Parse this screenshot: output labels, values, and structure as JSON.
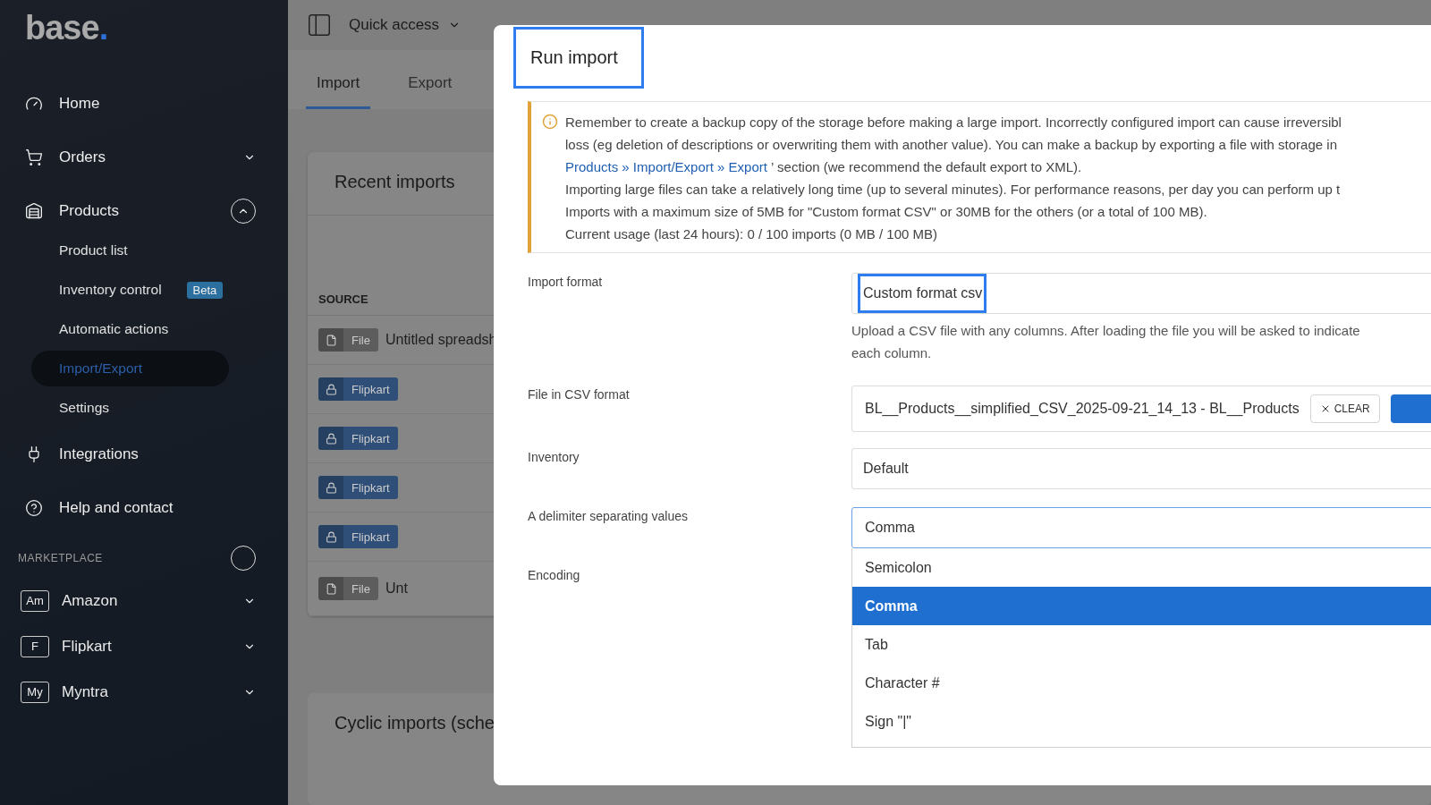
{
  "sidebar": {
    "logo": "base",
    "logo_dot": ".",
    "items": [
      {
        "label": "Home"
      },
      {
        "label": "Orders",
        "expanded": false
      },
      {
        "label": "Products",
        "expanded": true,
        "children": [
          {
            "label": "Product list",
            "selected": false
          },
          {
            "label": "Inventory control",
            "selected": false,
            "badge": "Beta"
          },
          {
            "label": "Automatic actions",
            "selected": false
          },
          {
            "label": "Import/Export",
            "selected": true
          },
          {
            "label": "Settings",
            "selected": false
          }
        ]
      },
      {
        "label": "Integrations"
      },
      {
        "label": "Help and contact"
      }
    ],
    "section": "MARKETPLACE",
    "marketplaces": [
      {
        "badge": "Am",
        "label": "Amazon"
      },
      {
        "badge": "F",
        "label": "Flipkart"
      },
      {
        "badge": "My",
        "label": "Myntra"
      }
    ]
  },
  "topbar": {
    "quick_access": "Quick access"
  },
  "tabs": [
    {
      "label": "Import",
      "selected": true
    },
    {
      "label": "Export",
      "selected": false
    }
  ],
  "recent_imports": {
    "title": "Recent imports",
    "column": "SOURCE",
    "rows": [
      {
        "kind": "file",
        "source": "File",
        "name": "Untitled spreadsh"
      },
      {
        "kind": "channel",
        "source": "Flipkart"
      },
      {
        "kind": "channel",
        "source": "Flipkart"
      },
      {
        "kind": "channel",
        "source": "Flipkart"
      },
      {
        "kind": "channel",
        "source": "Flipkart"
      },
      {
        "kind": "file",
        "source": "File",
        "name": "Unt"
      }
    ]
  },
  "cyclic_imports": {
    "title": "Cyclic imports (sche"
  },
  "modal": {
    "title": "Run import",
    "title_highlighted": true,
    "notice": [
      {
        "text": "Remember to create a backup copy of the storage before making a large import. Incorrectly configured import can cause irreversibl"
      },
      {
        "text": "loss (eg deletion of descriptions or overwriting them with another value). You can make a backup by exporting a file with storage in"
      },
      {
        "link": "Products » Import/Export » Export",
        "text": " ’ section (we recommend the default export to XML)."
      },
      {
        "text": "Importing large files can take a relatively long time (up to several minutes). For performance reasons, per day you can perform up t"
      },
      {
        "text": "Imports with a maximum size of 5MB for \"Custom format CSV\" or 30MB for the others (or a total of 100 MB)."
      },
      {
        "text": "Current usage (last 24 hours): 0 / 100 imports (0 MB / 100 MB)"
      }
    ],
    "fields": [
      {
        "kind": "select",
        "label": "Import format",
        "value": "Custom format csv",
        "highlighted": true,
        "hint": "Upload a CSV file with any columns. After loading the file you will be asked to indicate\neach column."
      },
      {
        "kind": "file",
        "label": "File in CSV format",
        "value": "BL__Products__simplified_CSV_2025-09-21_14_13 - BL__Products",
        "clear": "CLEAR"
      },
      {
        "kind": "select",
        "label": "Inventory",
        "value": "Default"
      },
      {
        "kind": "dropdown",
        "label": "A delimiter separating values",
        "value": "Comma",
        "focused": true,
        "options": [
          {
            "label": "Semicolon",
            "selected": false
          },
          {
            "label": "Comma",
            "selected": true
          },
          {
            "label": "Tab",
            "selected": false
          },
          {
            "label": "Character #",
            "selected": false
          },
          {
            "label": "Sign \"|\"",
            "selected": false
          }
        ]
      },
      {
        "kind": "empty",
        "label": "Encoding"
      }
    ]
  }
}
